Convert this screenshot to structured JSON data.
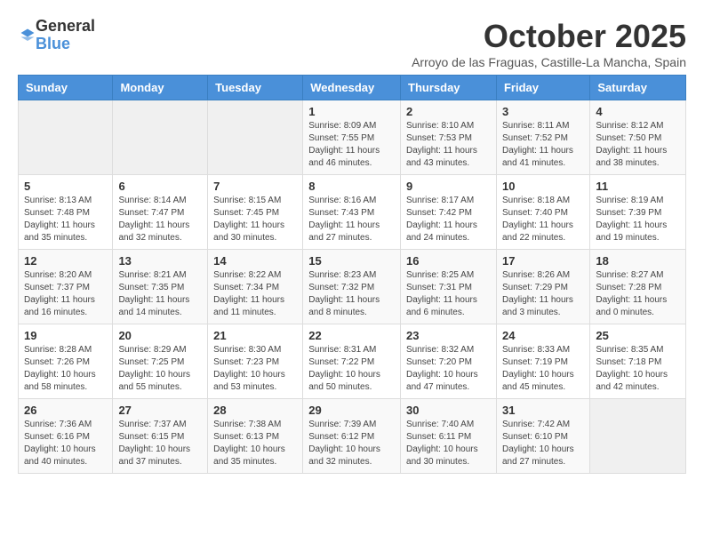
{
  "logo": {
    "general": "General",
    "blue": "Blue"
  },
  "title": "October 2025",
  "subtitle": "Arroyo de las Fraguas, Castille-La Mancha, Spain",
  "days_of_week": [
    "Sunday",
    "Monday",
    "Tuesday",
    "Wednesday",
    "Thursday",
    "Friday",
    "Saturday"
  ],
  "weeks": [
    [
      {
        "day": "",
        "info": ""
      },
      {
        "day": "",
        "info": ""
      },
      {
        "day": "",
        "info": ""
      },
      {
        "day": "1",
        "info": "Sunrise: 8:09 AM\nSunset: 7:55 PM\nDaylight: 11 hours and 46 minutes."
      },
      {
        "day": "2",
        "info": "Sunrise: 8:10 AM\nSunset: 7:53 PM\nDaylight: 11 hours and 43 minutes."
      },
      {
        "day": "3",
        "info": "Sunrise: 8:11 AM\nSunset: 7:52 PM\nDaylight: 11 hours and 41 minutes."
      },
      {
        "day": "4",
        "info": "Sunrise: 8:12 AM\nSunset: 7:50 PM\nDaylight: 11 hours and 38 minutes."
      }
    ],
    [
      {
        "day": "5",
        "info": "Sunrise: 8:13 AM\nSunset: 7:48 PM\nDaylight: 11 hours and 35 minutes."
      },
      {
        "day": "6",
        "info": "Sunrise: 8:14 AM\nSunset: 7:47 PM\nDaylight: 11 hours and 32 minutes."
      },
      {
        "day": "7",
        "info": "Sunrise: 8:15 AM\nSunset: 7:45 PM\nDaylight: 11 hours and 30 minutes."
      },
      {
        "day": "8",
        "info": "Sunrise: 8:16 AM\nSunset: 7:43 PM\nDaylight: 11 hours and 27 minutes."
      },
      {
        "day": "9",
        "info": "Sunrise: 8:17 AM\nSunset: 7:42 PM\nDaylight: 11 hours and 24 minutes."
      },
      {
        "day": "10",
        "info": "Sunrise: 8:18 AM\nSunset: 7:40 PM\nDaylight: 11 hours and 22 minutes."
      },
      {
        "day": "11",
        "info": "Sunrise: 8:19 AM\nSunset: 7:39 PM\nDaylight: 11 hours and 19 minutes."
      }
    ],
    [
      {
        "day": "12",
        "info": "Sunrise: 8:20 AM\nSunset: 7:37 PM\nDaylight: 11 hours and 16 minutes."
      },
      {
        "day": "13",
        "info": "Sunrise: 8:21 AM\nSunset: 7:35 PM\nDaylight: 11 hours and 14 minutes."
      },
      {
        "day": "14",
        "info": "Sunrise: 8:22 AM\nSunset: 7:34 PM\nDaylight: 11 hours and 11 minutes."
      },
      {
        "day": "15",
        "info": "Sunrise: 8:23 AM\nSunset: 7:32 PM\nDaylight: 11 hours and 8 minutes."
      },
      {
        "day": "16",
        "info": "Sunrise: 8:25 AM\nSunset: 7:31 PM\nDaylight: 11 hours and 6 minutes."
      },
      {
        "day": "17",
        "info": "Sunrise: 8:26 AM\nSunset: 7:29 PM\nDaylight: 11 hours and 3 minutes."
      },
      {
        "day": "18",
        "info": "Sunrise: 8:27 AM\nSunset: 7:28 PM\nDaylight: 11 hours and 0 minutes."
      }
    ],
    [
      {
        "day": "19",
        "info": "Sunrise: 8:28 AM\nSunset: 7:26 PM\nDaylight: 10 hours and 58 minutes."
      },
      {
        "day": "20",
        "info": "Sunrise: 8:29 AM\nSunset: 7:25 PM\nDaylight: 10 hours and 55 minutes."
      },
      {
        "day": "21",
        "info": "Sunrise: 8:30 AM\nSunset: 7:23 PM\nDaylight: 10 hours and 53 minutes."
      },
      {
        "day": "22",
        "info": "Sunrise: 8:31 AM\nSunset: 7:22 PM\nDaylight: 10 hours and 50 minutes."
      },
      {
        "day": "23",
        "info": "Sunrise: 8:32 AM\nSunset: 7:20 PM\nDaylight: 10 hours and 47 minutes."
      },
      {
        "day": "24",
        "info": "Sunrise: 8:33 AM\nSunset: 7:19 PM\nDaylight: 10 hours and 45 minutes."
      },
      {
        "day": "25",
        "info": "Sunrise: 8:35 AM\nSunset: 7:18 PM\nDaylight: 10 hours and 42 minutes."
      }
    ],
    [
      {
        "day": "26",
        "info": "Sunrise: 7:36 AM\nSunset: 6:16 PM\nDaylight: 10 hours and 40 minutes."
      },
      {
        "day": "27",
        "info": "Sunrise: 7:37 AM\nSunset: 6:15 PM\nDaylight: 10 hours and 37 minutes."
      },
      {
        "day": "28",
        "info": "Sunrise: 7:38 AM\nSunset: 6:13 PM\nDaylight: 10 hours and 35 minutes."
      },
      {
        "day": "29",
        "info": "Sunrise: 7:39 AM\nSunset: 6:12 PM\nDaylight: 10 hours and 32 minutes."
      },
      {
        "day": "30",
        "info": "Sunrise: 7:40 AM\nSunset: 6:11 PM\nDaylight: 10 hours and 30 minutes."
      },
      {
        "day": "31",
        "info": "Sunrise: 7:42 AM\nSunset: 6:10 PM\nDaylight: 10 hours and 27 minutes."
      },
      {
        "day": "",
        "info": ""
      }
    ]
  ]
}
